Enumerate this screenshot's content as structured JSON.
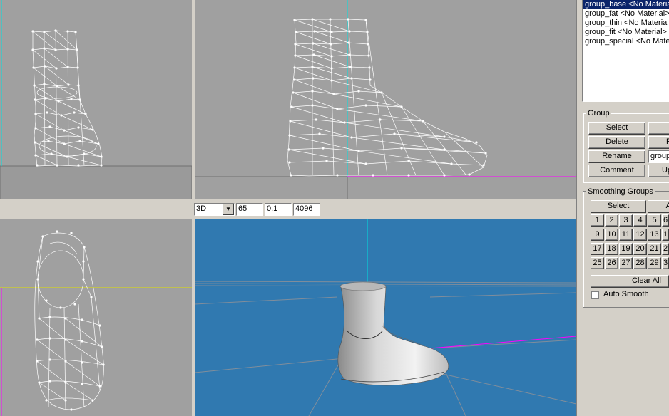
{
  "groups_list": {
    "items": [
      {
        "label": "group_base <No Material>",
        "selected": true
      },
      {
        "label": "group_fat <No Material>",
        "selected": false
      },
      {
        "label": "group_thin <No Material>",
        "selected": false
      },
      {
        "label": "group_fit <No Material>",
        "selected": false
      },
      {
        "label": "group_special <No Material>",
        "selected": false
      }
    ]
  },
  "group_panel": {
    "title": "Group",
    "select": "Select",
    "delete": "Delete",
    "rename": "Rename",
    "comment": "Comment",
    "r_button": "R",
    "up_button": "Up",
    "name_field": "group_base"
  },
  "smoothing_panel": {
    "title": "Smoothing Groups",
    "select": "Select",
    "a_button": "A",
    "numbers": [
      "1",
      "2",
      "3",
      "4",
      "5",
      "6",
      "9",
      "10",
      "11",
      "12",
      "13",
      "1",
      "17",
      "18",
      "19",
      "20",
      "21",
      "2",
      "25",
      "26",
      "27",
      "28",
      "29",
      "3"
    ],
    "clear_all": "Clear All",
    "auto_smooth_label": "Auto Smooth",
    "auto_smooth_checked": false
  },
  "viewport_toolbar": {
    "view_mode": "3D",
    "field_fov": "65",
    "field_near": "0.1",
    "field_far": "4096"
  },
  "colors": {
    "viewport_gray": "#a0a0a0",
    "viewport_3d": "#3079b0",
    "wire": "#ffffff",
    "axis_cyan": "#00ffff",
    "axis_magenta": "#ff00ff",
    "axis_yellow": "#ffff00",
    "selection": "#0a246a"
  }
}
